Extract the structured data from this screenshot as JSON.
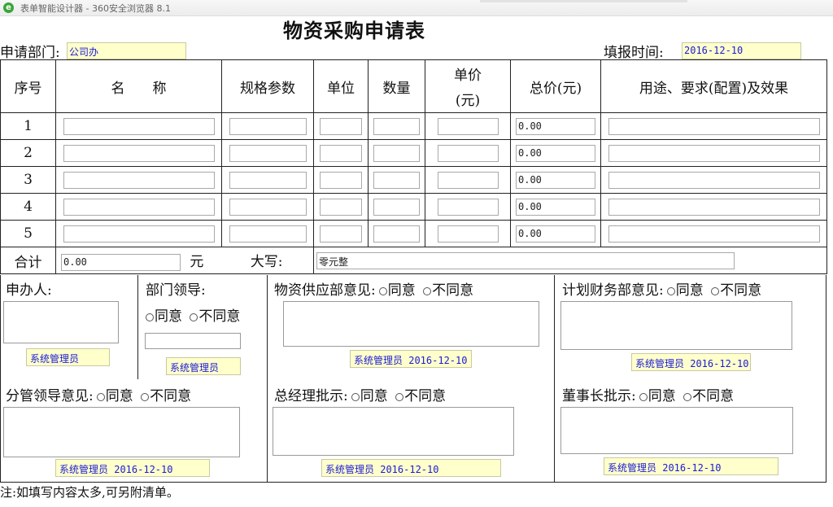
{
  "window": {
    "title": "表单智能设计器 - 360安全浏览器 8.1"
  },
  "form": {
    "title": "物资采购申请表",
    "department_label": "申请部门:",
    "department_value": "公司办",
    "fill_time_label": "填报时间:",
    "fill_time_value": "2016-12-10"
  },
  "table": {
    "headers": {
      "seq": "序号",
      "name": "名　　称",
      "spec": "规格参数",
      "unit": "单位",
      "qty": "数量",
      "price_line1": "单价",
      "price_line2": "(元)",
      "total": "总价(元)",
      "use": "用途、要求(配置)及效果"
    },
    "rows": [
      {
        "seq": "1",
        "total": "0.00"
      },
      {
        "seq": "2",
        "total": "0.00"
      },
      {
        "seq": "3",
        "total": "0.00"
      },
      {
        "seq": "4",
        "total": "0.00"
      },
      {
        "seq": "5",
        "total": "0.00"
      }
    ],
    "sum_label": "合计",
    "sum_value": "0.00",
    "sum_unit": "元",
    "uppercase_label": "大写:",
    "uppercase_value": "零元整"
  },
  "approvals": {
    "agree": "同意",
    "disagree": "不同意",
    "applicant_label": "申办人:",
    "applicant_sign": "系统管理员",
    "dept_leader_label": "部门领导:",
    "dept_leader_sign": "系统管理员",
    "supply_label": "物资供应部意见:",
    "supply_sign": "系统管理员 2016-12-10",
    "finance_label": "计划财务部意见:",
    "finance_sign": "系统管理员 2016-12-10",
    "branch_leader_label": "分管领导意见:",
    "branch_leader_sign": "系统管理员 2016-12-10",
    "gm_label": "总经理批示:",
    "gm_sign": "系统管理员 2016-12-10",
    "chairman_label": "董事长批示:",
    "chairman_sign": "系统管理员 2016-12-10"
  },
  "footnote": "注:如填写内容太多,可另附清单。"
}
